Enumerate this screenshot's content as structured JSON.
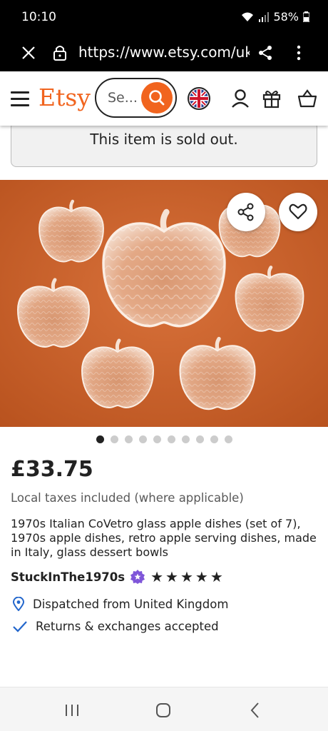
{
  "status_bar": {
    "time": "10:10",
    "battery": "58%",
    "icons": [
      "wifi-icon",
      "signal-icon",
      "battery-icon"
    ]
  },
  "browser": {
    "url": "https://www.etsy.com/uk",
    "icons": [
      "close-icon",
      "lock-icon",
      "share-icon",
      "more-icon"
    ]
  },
  "header": {
    "logo": "Etsy",
    "search_placeholder": "Se...",
    "brand_color": "#f1641e",
    "icons": [
      "menu-icon",
      "search-icon",
      "uk-flag-icon",
      "account-icon",
      "gift-icon",
      "basket-icon"
    ]
  },
  "notice": {
    "sold_out": "This item is sold out."
  },
  "listing": {
    "image_alt": "glass apple dishes on orange background",
    "carousel": {
      "total": 10,
      "active": 1
    },
    "overlay_icons": [
      "share-icon",
      "heart-icon"
    ],
    "price": "£33.75",
    "taxes_note": "Local taxes included (where applicable)",
    "title": "1970s Italian CoVetro glass apple dishes (set of 7), 1970s apple dishes, retro apple serving dishes, made in Italy, glass dessert bowls",
    "seller": "StuckInThe1970s",
    "rating_stars": 5,
    "dispatch": "Dispatched from United Kingdom",
    "returns": "Returns & exchanges accepted"
  },
  "android_nav": {
    "icons": [
      "recent-apps-icon",
      "home-icon",
      "back-icon"
    ]
  }
}
